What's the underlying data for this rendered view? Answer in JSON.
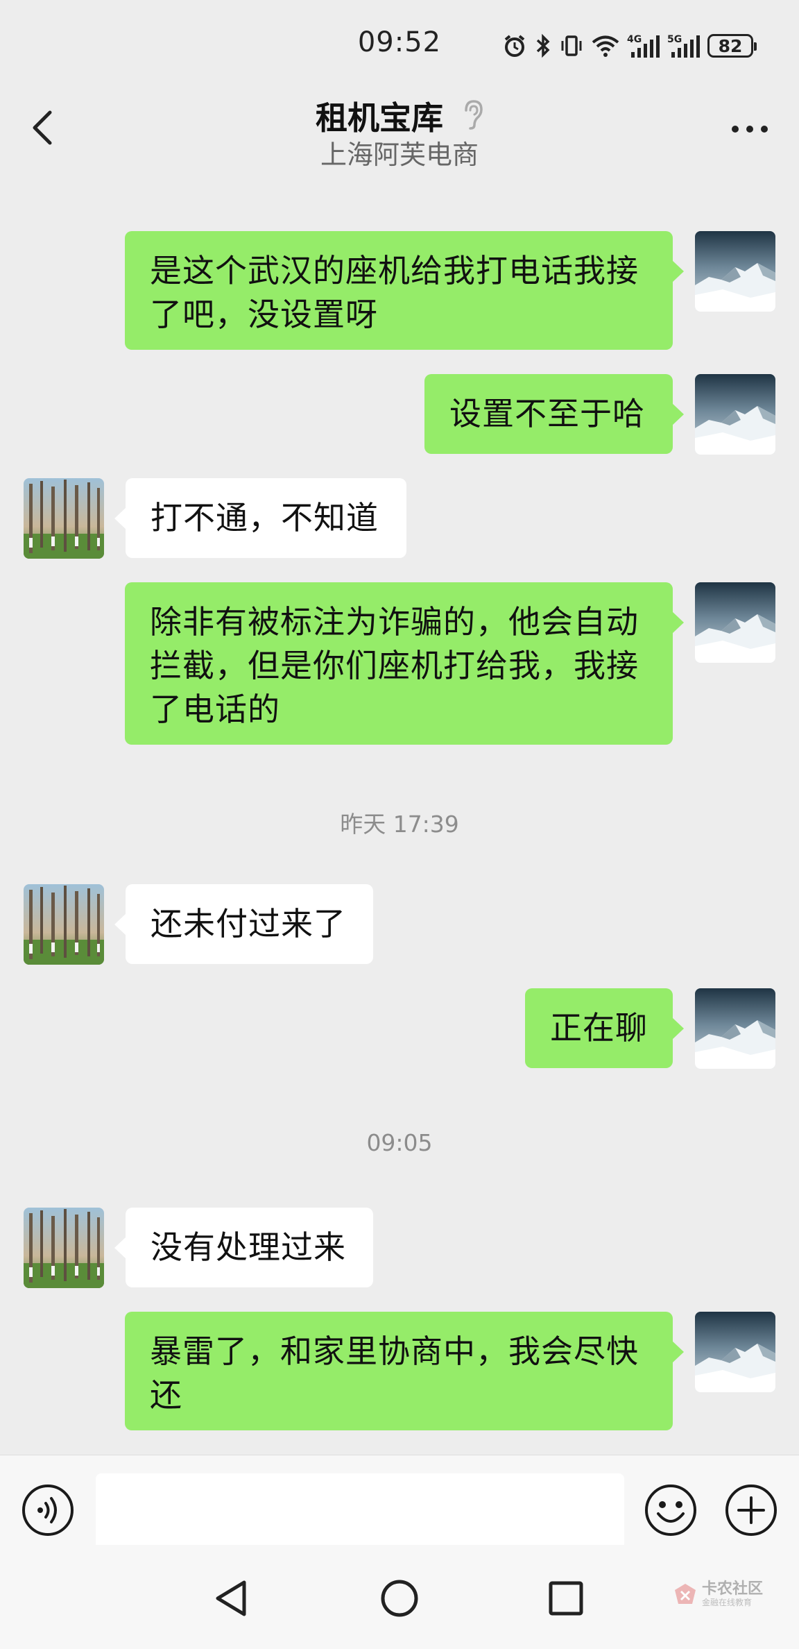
{
  "status_bar": {
    "time": "09:52",
    "net_4g": "4G",
    "net_5g": "5G",
    "battery": "82",
    "icons": [
      "alarm-icon",
      "bluetooth-icon",
      "vibrate-icon",
      "wifi-icon",
      "signal-4g-icon",
      "signal-5g-icon",
      "battery-icon"
    ]
  },
  "header": {
    "title": "租机宝库",
    "subtitle": "上海阿芙电商",
    "left_icon": "back-icon",
    "title_icon": "ear-icon",
    "right_icon": "more-icon"
  },
  "messages": [
    {
      "sender": "me",
      "text": "是这个武汉的座机给我打电话我接了吧，没设置呀"
    },
    {
      "sender": "me",
      "text": "设置不至于哈"
    },
    {
      "sender": "them",
      "text": "打不通，不知道"
    },
    {
      "sender": "me",
      "text": "除非有被标注为诈骗的，他会自动拦截，但是你们座机打给我，我接了电话的"
    },
    {
      "type": "timestamp",
      "text": "昨天 17:39"
    },
    {
      "sender": "them",
      "text": "还未付过来了"
    },
    {
      "sender": "me",
      "text": "正在聊"
    },
    {
      "type": "timestamp",
      "text": "09:05"
    },
    {
      "sender": "them",
      "text": "没有处理过来"
    },
    {
      "sender": "me",
      "text": "暴雷了，和家里协商中，我会尽快还"
    }
  ],
  "input_bar": {
    "value": "",
    "icons": [
      "voice-icon",
      "emoji-icon",
      "plus-icon"
    ]
  },
  "system_nav": {
    "icons": [
      "nav-back-icon",
      "nav-home-icon",
      "nav-recents-icon"
    ]
  },
  "watermark": {
    "title": "卡农社区",
    "subtitle": "金融在线教育"
  },
  "colors": {
    "background": "#ededed",
    "my_bubble": "#95ec69",
    "their_bubble": "#ffffff",
    "timestamp": "#8c8c8c"
  }
}
